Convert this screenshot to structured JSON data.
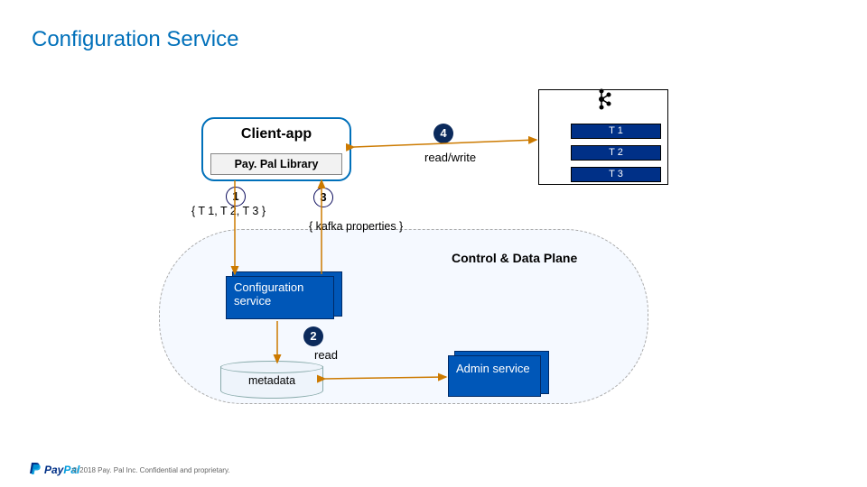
{
  "title": "Configuration Service",
  "client_app": {
    "label": "Client-app",
    "library_label": "Pay. Pal Library"
  },
  "topics_list": "{ T 1, T 2, T 3 }",
  "kafka_props": "{ kafka properties }",
  "steps": {
    "s1": "1",
    "s2": "2",
    "s3": "3",
    "s4": "4"
  },
  "labels": {
    "read_write": "read/write",
    "read": "read",
    "plane": "Control & Data Plane"
  },
  "config_service": "Configuration service",
  "admin_service": "Admin service",
  "metadata": "metadata",
  "topics": {
    "t1": "T 1",
    "t2": "T 2",
    "t3": "T 3"
  },
  "footer": "© 2018 Pay. Pal Inc. Confidential and proprietary.",
  "brand": {
    "pay": "Pay",
    "pal": "Pal"
  }
}
